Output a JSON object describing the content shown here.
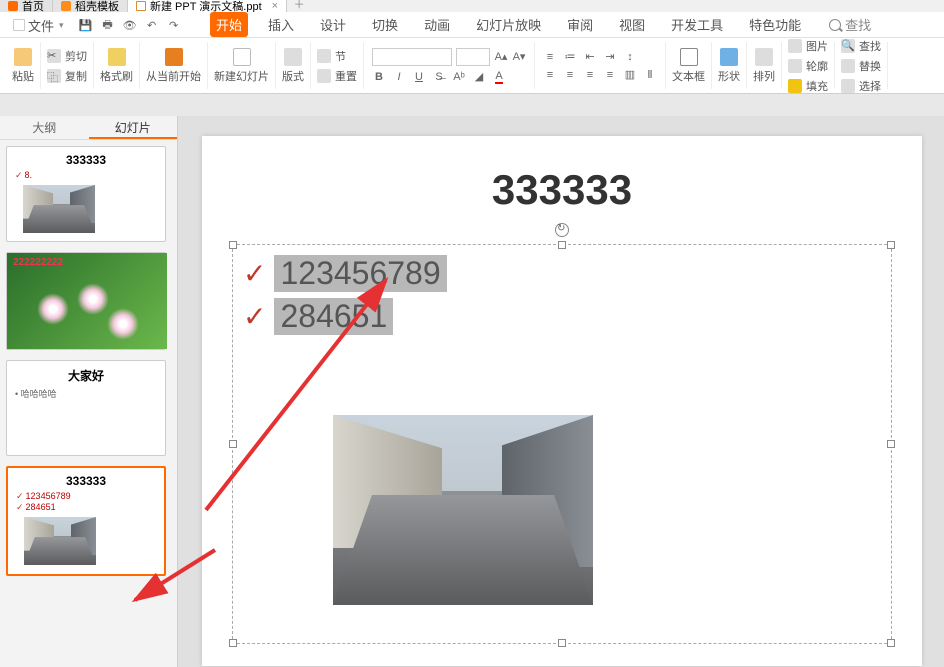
{
  "tabs": {
    "home": "首页",
    "templates": "稻壳模板",
    "current": "新建 PPT 演示文稿.ppt"
  },
  "menu": {
    "file": "文件"
  },
  "ribbon_tabs": {
    "start": "开始",
    "insert": "插入",
    "design": "设计",
    "transition": "切换",
    "anim": "动画",
    "slideshow": "幻灯片放映",
    "review": "审阅",
    "view": "视图",
    "dev": "开发工具",
    "special": "特色功能",
    "search": "查找"
  },
  "ribbon": {
    "paste": "粘贴",
    "cut": "剪切",
    "copy": "复制",
    "fmtpaint": "格式刷",
    "fromcurrent": "从当前开始",
    "newslide": "新建幻灯片",
    "layout": "版式",
    "section": "节",
    "reset": "重置",
    "textbox": "文本框",
    "shape": "形状",
    "arrange": "排列",
    "pic": "图片",
    "outline": "轮廓",
    "fill": "填充",
    "find": "查找",
    "replace": "替换",
    "select": "选择"
  },
  "sidebar": {
    "outline": "大纲",
    "slides": "幻灯片"
  },
  "thumbs": {
    "s1": {
      "title": "333333",
      "b1": "8."
    },
    "s2": {
      "txt": "222222222"
    },
    "s3": {
      "title": "大家好",
      "b1": "哈哈哈哈"
    },
    "s4": {
      "title": "333333",
      "b1": "123456789",
      "b2": "284651"
    }
  },
  "slide": {
    "title": "333333",
    "line1": "123456789",
    "line2": "284651"
  }
}
